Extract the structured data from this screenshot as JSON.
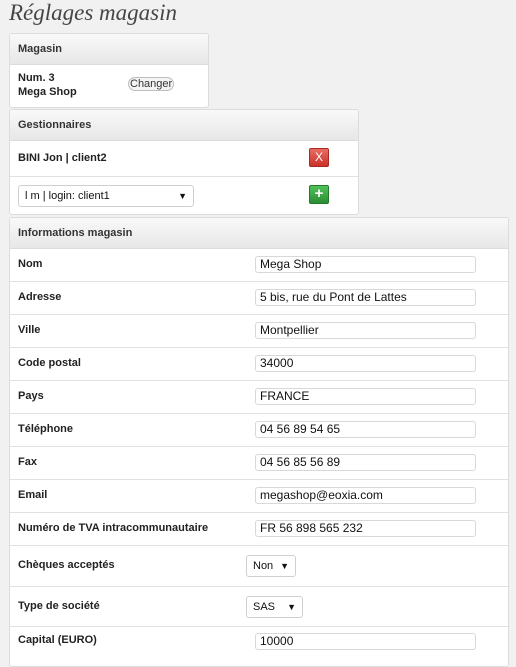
{
  "page": {
    "title": "Réglages magasin"
  },
  "store_panel": {
    "header": "Magasin",
    "number": "Num. 3",
    "name": "Mega Shop",
    "change_label": "Changer"
  },
  "managers_panel": {
    "header": "Gestionnaires",
    "manager": "BINI Jon | client2",
    "delete_label": "X",
    "select_value": "l m | login: client1",
    "add_label": "+"
  },
  "info_panel": {
    "header": "Informations magasin",
    "fields": {
      "nom": {
        "label": "Nom",
        "value": "Mega Shop"
      },
      "adresse": {
        "label": "Adresse",
        "value": "5 bis, rue du Pont de Lattes"
      },
      "ville": {
        "label": "Ville",
        "value": "Montpellier"
      },
      "code_postal": {
        "label": "Code postal",
        "value": "34000"
      },
      "pays": {
        "label": "Pays",
        "value": "FRANCE"
      },
      "telephone": {
        "label": "Téléphone",
        "value": "04 56 89 54 65"
      },
      "fax": {
        "label": "Fax",
        "value": "04 56 85 56 89"
      },
      "email": {
        "label": "Email",
        "value": "megashop@eoxia.com"
      },
      "tva": {
        "label": "Numéro de TVA intracommunautaire",
        "value": "FR 56 898 565 232"
      },
      "cheques": {
        "label": "Chèques acceptés",
        "value": "Non"
      },
      "type_societe": {
        "label": "Type de société",
        "value": "SAS"
      },
      "capital": {
        "label": "Capital (EURO)",
        "value": "10000"
      }
    }
  },
  "icons": {
    "dropdown": "chevron-down-icon",
    "delete": "close-icon",
    "add": "plus-icon"
  },
  "colors": {
    "delete": "#d9473e",
    "add": "#3aa845",
    "header_bg": "#ececec"
  }
}
